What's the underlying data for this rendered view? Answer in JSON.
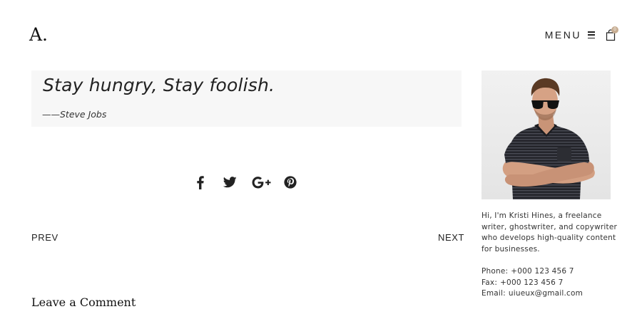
{
  "header": {
    "logo": "A.",
    "menu_label": "MENU",
    "cart_count": "0"
  },
  "quote": {
    "text": "Stay hungry, Stay foolish.",
    "author": "——Steve Jobs"
  },
  "share": {
    "icons": [
      "facebook-icon",
      "twitter-icon",
      "google-plus-icon",
      "pinterest-icon"
    ]
  },
  "pagination": {
    "prev_label": "PREV",
    "next_label": "NEXT"
  },
  "comments": {
    "heading": "Leave a Comment"
  },
  "sidebar": {
    "bio": "Hi, I'm Kristi Hines, a freelance writer, ghostwriter, and copywriter who develops high-quality content for businesses.",
    "phone_label": "Phone:",
    "phone_value": "+000 123 456 7",
    "fax_label": "Fax:",
    "fax_value": "+000 123 456 7",
    "email_label": "Email:",
    "email_value": "uiueux@gmail.com"
  },
  "colors": {
    "accent": "#c7ad92",
    "quote_bg": "#f7f7f7",
    "text": "#222222"
  }
}
